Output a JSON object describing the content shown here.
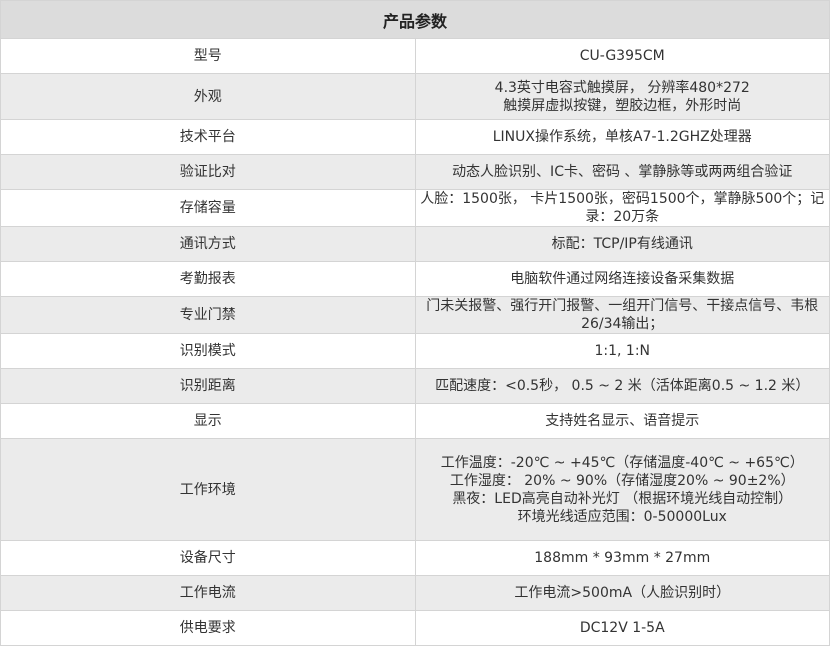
{
  "title": "产品参数",
  "rows": [
    {
      "label": "型号",
      "value": [
        "CU-G395CM"
      ]
    },
    {
      "label": "外观",
      "value": [
        "4.3英寸电容式触摸屏， 分辨率480*272",
        "触摸屏虚拟按键，塑胶边框，外形时尚"
      ]
    },
    {
      "label": "技术平台",
      "value": [
        "LINUX操作系统，单核A7-1.2GHZ处理器"
      ]
    },
    {
      "label": "验证比对",
      "value": [
        "动态人脸识别、IC卡、密码 、掌静脉等或两两组合验证"
      ]
    },
    {
      "label": "存储容量",
      "value": [
        "人脸：1500张， 卡片1500张，密码1500个，掌静脉500个；记录：20万条"
      ]
    },
    {
      "label": "通讯方式",
      "value": [
        "标配：TCP/IP有线通讯"
      ]
    },
    {
      "label": "考勤报表",
      "value": [
        "电脑软件通过网络连接设备采集数据"
      ]
    },
    {
      "label": "专业门禁",
      "value": [
        "门未关报警、强行开门报警、一组开门信号、干接点信号、韦根26/34输出；"
      ]
    },
    {
      "label": "识别模式",
      "value": [
        "1:1, 1:N"
      ]
    },
    {
      "label": "识别距离",
      "value": [
        "匹配速度：<0.5秒， 0.5 ~ 2 米（活体距离0.5 ~ 1.2 米）"
      ]
    },
    {
      "label": "显示",
      "value": [
        "支持姓名显示、语音提示"
      ]
    },
    {
      "label": "工作环境",
      "value": [
        "工作温度：-20℃ ~ +45℃（存储温度-40℃ ~ +65℃）",
        "工作湿度： 20% ~ 90%（存储湿度20% ~ 90±2%）",
        "黑夜：LED高亮自动补光灯 （根据环境光线自动控制）",
        "环境光线适应范围：0-50000Lux"
      ]
    },
    {
      "label": "设备尺寸",
      "value": [
        "188mm * 93mm * 27mm"
      ]
    },
    {
      "label": "工作电流",
      "value": [
        "工作电流>500mA（人脸识别时）"
      ]
    },
    {
      "label": "供电要求",
      "value": [
        "DC12V 1-5A"
      ]
    }
  ]
}
